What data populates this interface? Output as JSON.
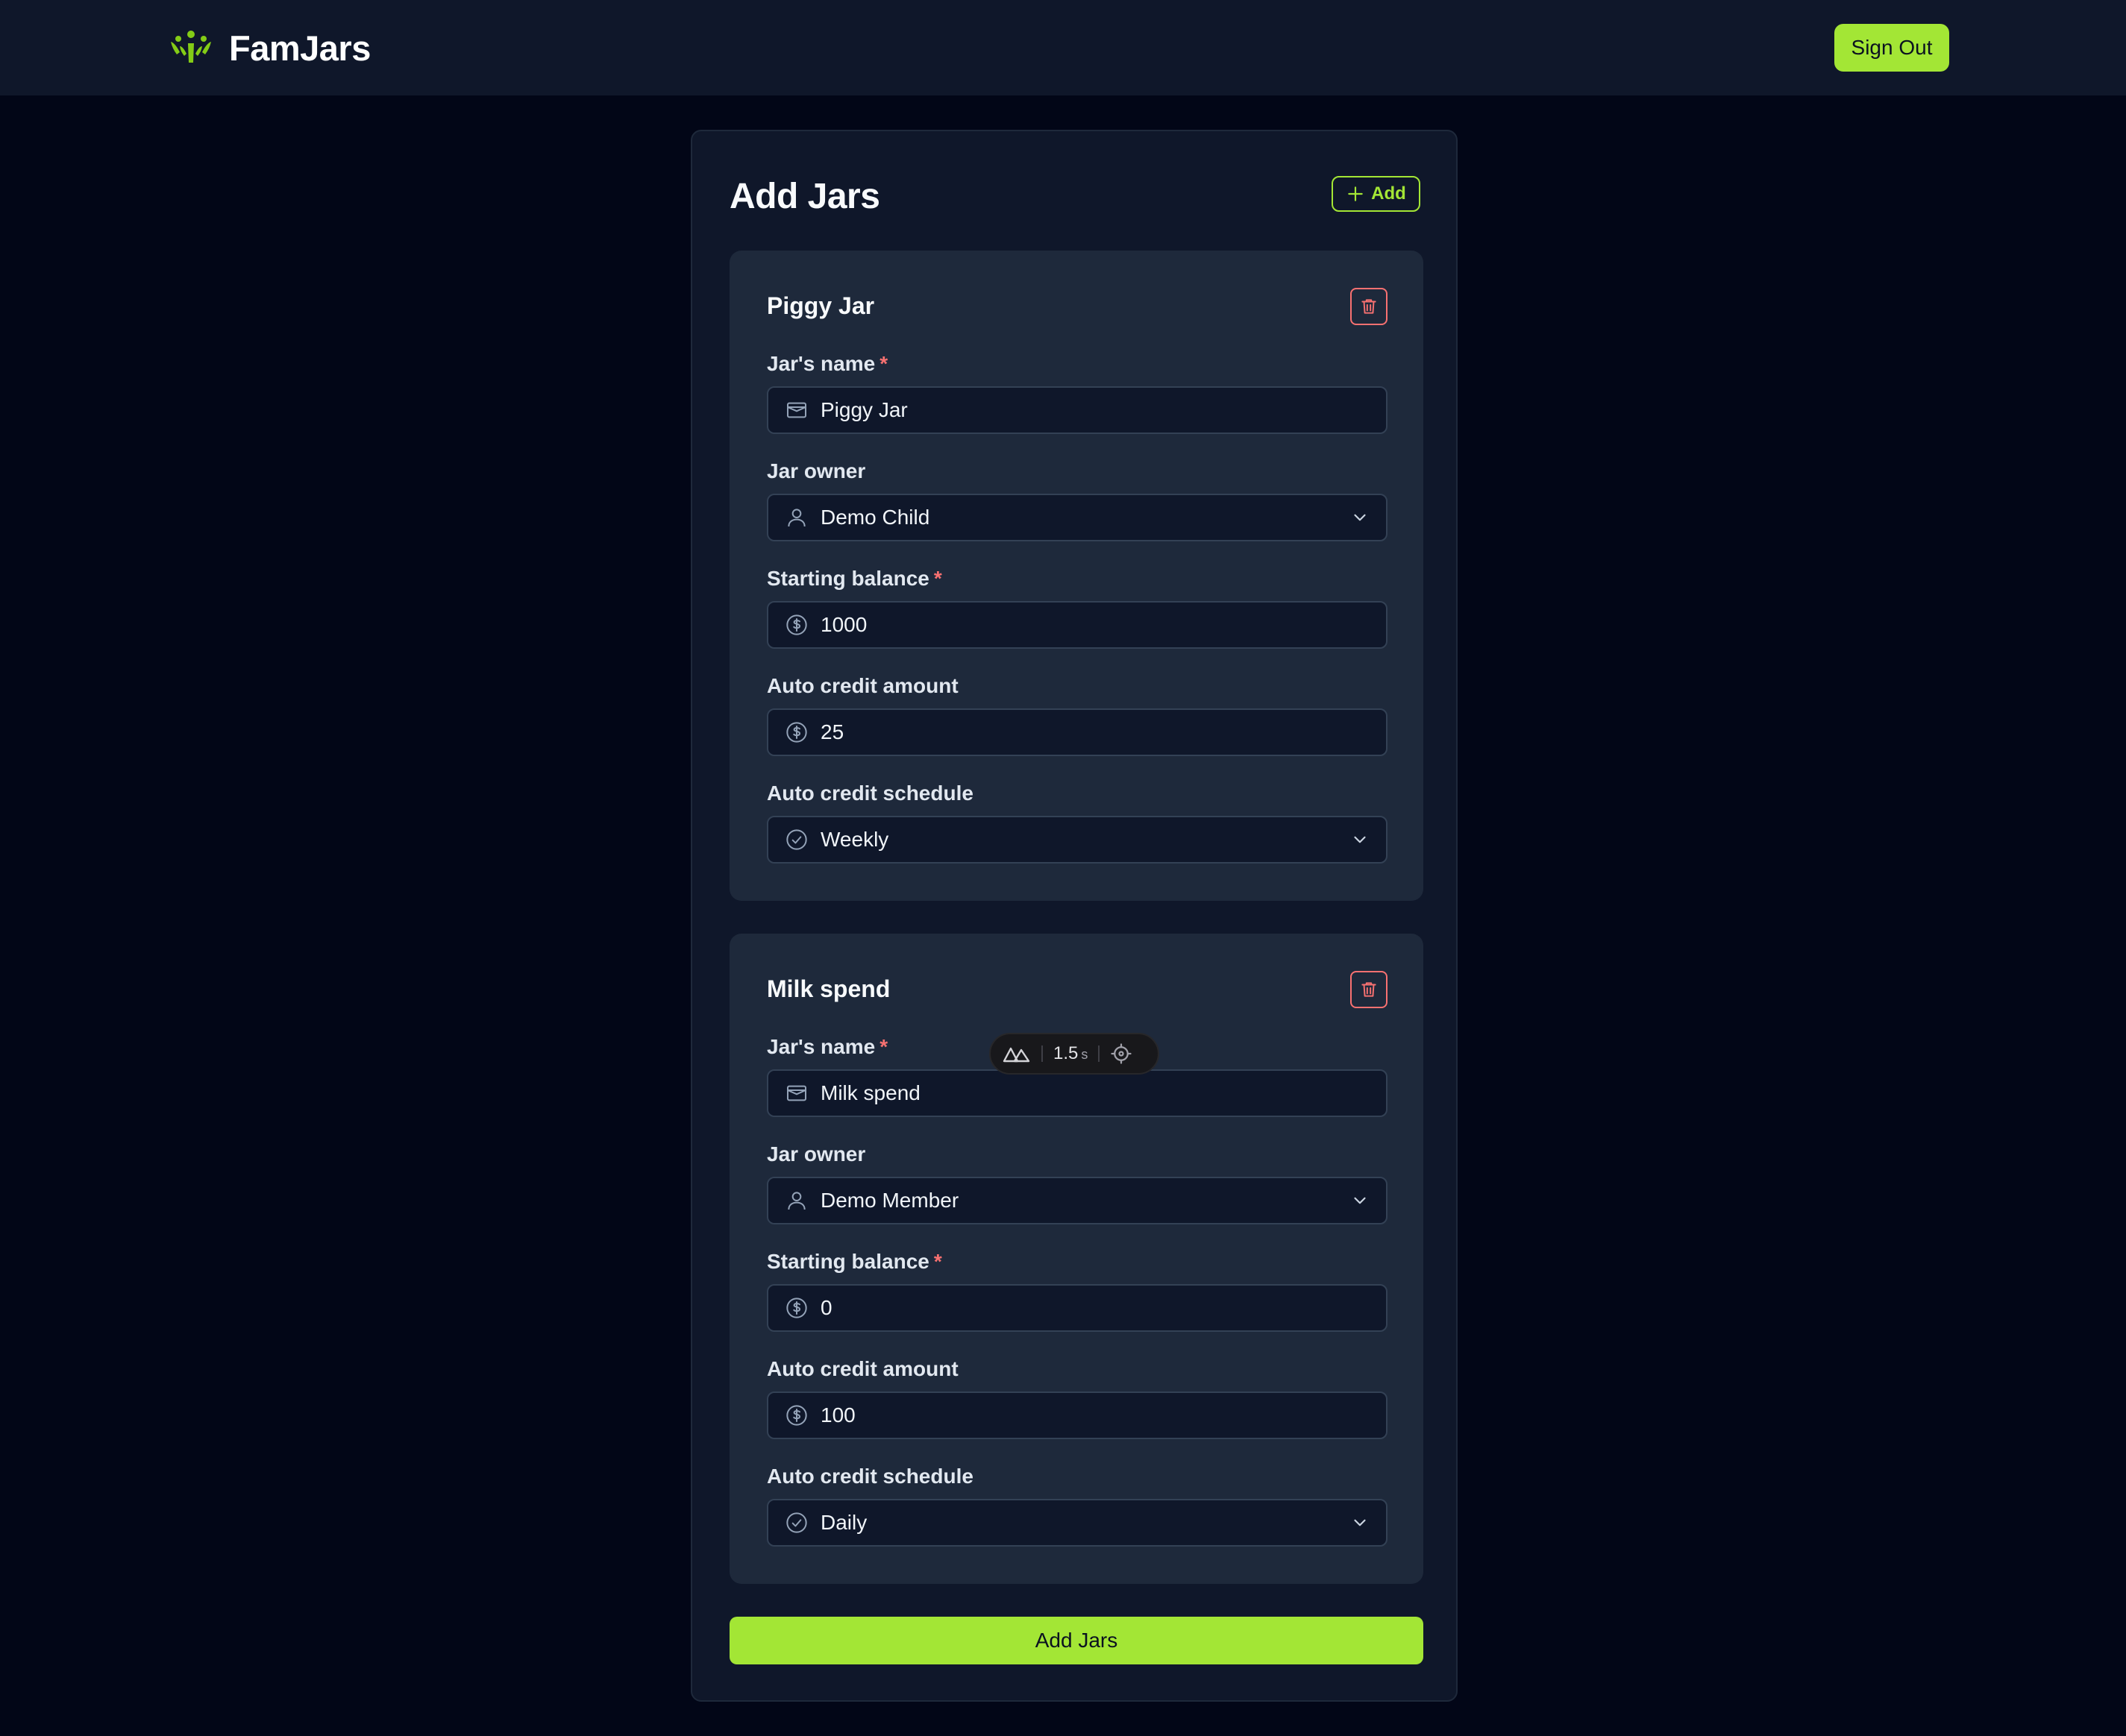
{
  "header": {
    "brand": "FamJars",
    "sign_out_label": "Sign Out"
  },
  "card": {
    "title": "Add Jars",
    "add_label": "Add"
  },
  "jars": [
    {
      "title": "Piggy Jar",
      "name_label": "Jar's name",
      "name_value": "Piggy Jar",
      "owner_label": "Jar owner",
      "owner_value": "Demo Child",
      "balance_label": "Starting balance",
      "balance_value": "1000",
      "credit_label": "Auto credit amount",
      "credit_value": "25",
      "schedule_label": "Auto credit schedule",
      "schedule_value": "Weekly"
    },
    {
      "title": "Milk spend",
      "name_label": "Jar's name",
      "name_value": "Milk spend",
      "owner_label": "Jar owner",
      "owner_value": "Demo Member",
      "balance_label": "Starting balance",
      "balance_value": "0",
      "credit_label": "Auto credit amount",
      "credit_value": "100",
      "schedule_label": "Auto credit schedule",
      "schedule_value": "Daily"
    }
  ],
  "required_marker": "*",
  "submit_label": "Add Jars",
  "devtools": {
    "time": "1.5",
    "unit": "s"
  },
  "colors": {
    "accent": "#a3e635",
    "danger": "#f87171",
    "page_bg": "#020617",
    "panel_bg": "#0f172a",
    "jar_bg": "#1e293b"
  },
  "icons": {
    "brand": "famjars-logo-icon",
    "name_field": "wallet-icon",
    "owner_field": "user-icon",
    "money_field": "dollar-circle-icon",
    "schedule_field": "check-circle-icon",
    "dropdown": "chevron-down-icon",
    "delete": "trash-icon",
    "add": "plus-icon"
  }
}
